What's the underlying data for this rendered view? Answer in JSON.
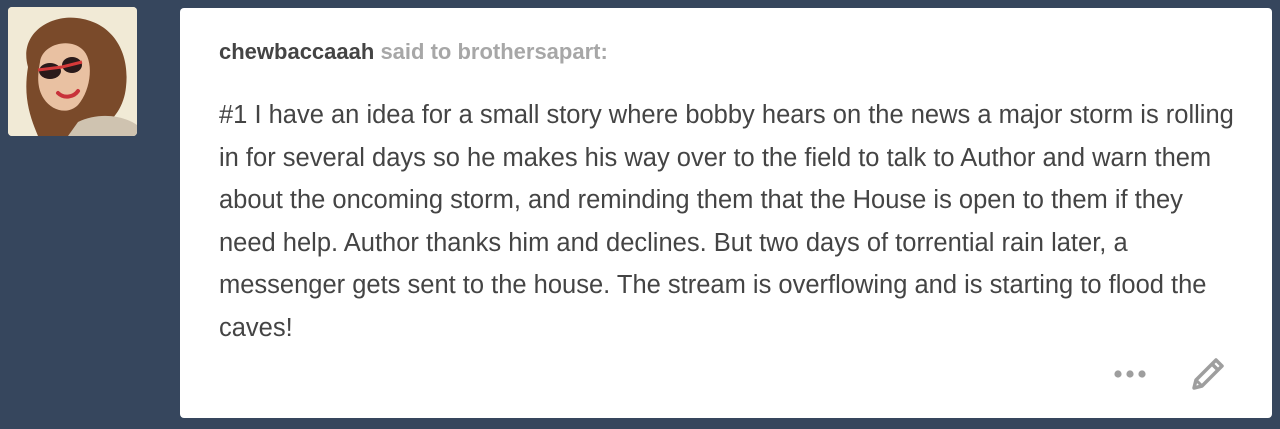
{
  "post": {
    "asker": "chewbaccaaah",
    "said_to": "said to brothersapart:",
    "body": "#1 I have an idea for a small story where bobby hears on the news a major storm is rolling in for several days so he makes his way over to the field to talk to Author and warn them about the oncoming storm, and reminding them that the House is open to them if they need help. Author thanks him and declines. But two days of torrential rain later, a messenger gets sent to the house. The stream is overflowing and is starting to flood the caves!"
  },
  "icons": {
    "more": "more-options-icon",
    "edit": "pencil-icon"
  },
  "colors": {
    "background": "#36465d",
    "card": "#ffffff",
    "text": "#444444",
    "muted": "#a7a7a7",
    "icon": "#9e9e9e"
  }
}
